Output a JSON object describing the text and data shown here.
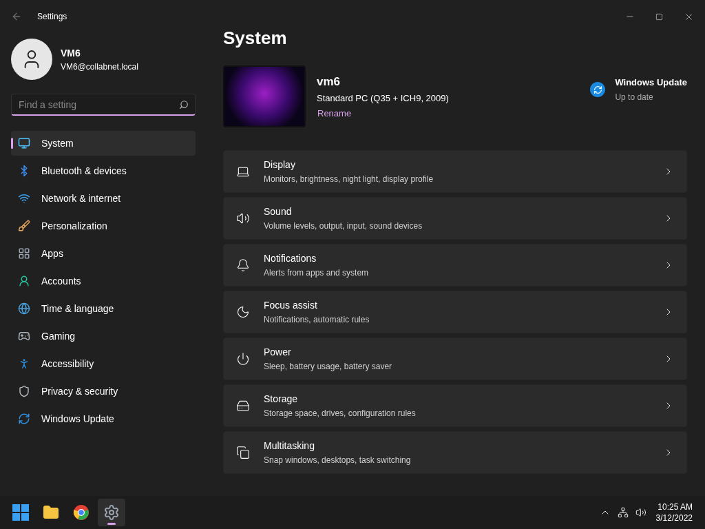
{
  "window": {
    "title": "Settings"
  },
  "user": {
    "name": "VM6",
    "email": "VM6@collabnet.local"
  },
  "search": {
    "placeholder": "Find a setting"
  },
  "nav": [
    {
      "label": "System",
      "selected": true
    },
    {
      "label": "Bluetooth & devices",
      "selected": false
    },
    {
      "label": "Network & internet",
      "selected": false
    },
    {
      "label": "Personalization",
      "selected": false
    },
    {
      "label": "Apps",
      "selected": false
    },
    {
      "label": "Accounts",
      "selected": false
    },
    {
      "label": "Time & language",
      "selected": false
    },
    {
      "label": "Gaming",
      "selected": false
    },
    {
      "label": "Accessibility",
      "selected": false
    },
    {
      "label": "Privacy & security",
      "selected": false
    },
    {
      "label": "Windows Update",
      "selected": false
    }
  ],
  "page_title": "System",
  "device": {
    "name": "vm6",
    "model": "Standard PC (Q35 + ICH9, 2009)",
    "rename": "Rename"
  },
  "update": {
    "title": "Windows Update",
    "status": "Up to date"
  },
  "settings": [
    {
      "title": "Display",
      "subtitle": "Monitors, brightness, night light, display profile"
    },
    {
      "title": "Sound",
      "subtitle": "Volume levels, output, input, sound devices"
    },
    {
      "title": "Notifications",
      "subtitle": "Alerts from apps and system"
    },
    {
      "title": "Focus assist",
      "subtitle": "Notifications, automatic rules"
    },
    {
      "title": "Power",
      "subtitle": "Sleep, battery usage, battery saver"
    },
    {
      "title": "Storage",
      "subtitle": "Storage space, drives, configuration rules"
    },
    {
      "title": "Multitasking",
      "subtitle": "Snap windows, desktops, task switching"
    }
  ],
  "taskbar": {
    "apps": [
      {
        "active": false
      },
      {
        "active": false
      },
      {
        "active": false
      },
      {
        "active": true
      }
    ],
    "time": "10:25 AM",
    "date": "3/12/2022"
  }
}
